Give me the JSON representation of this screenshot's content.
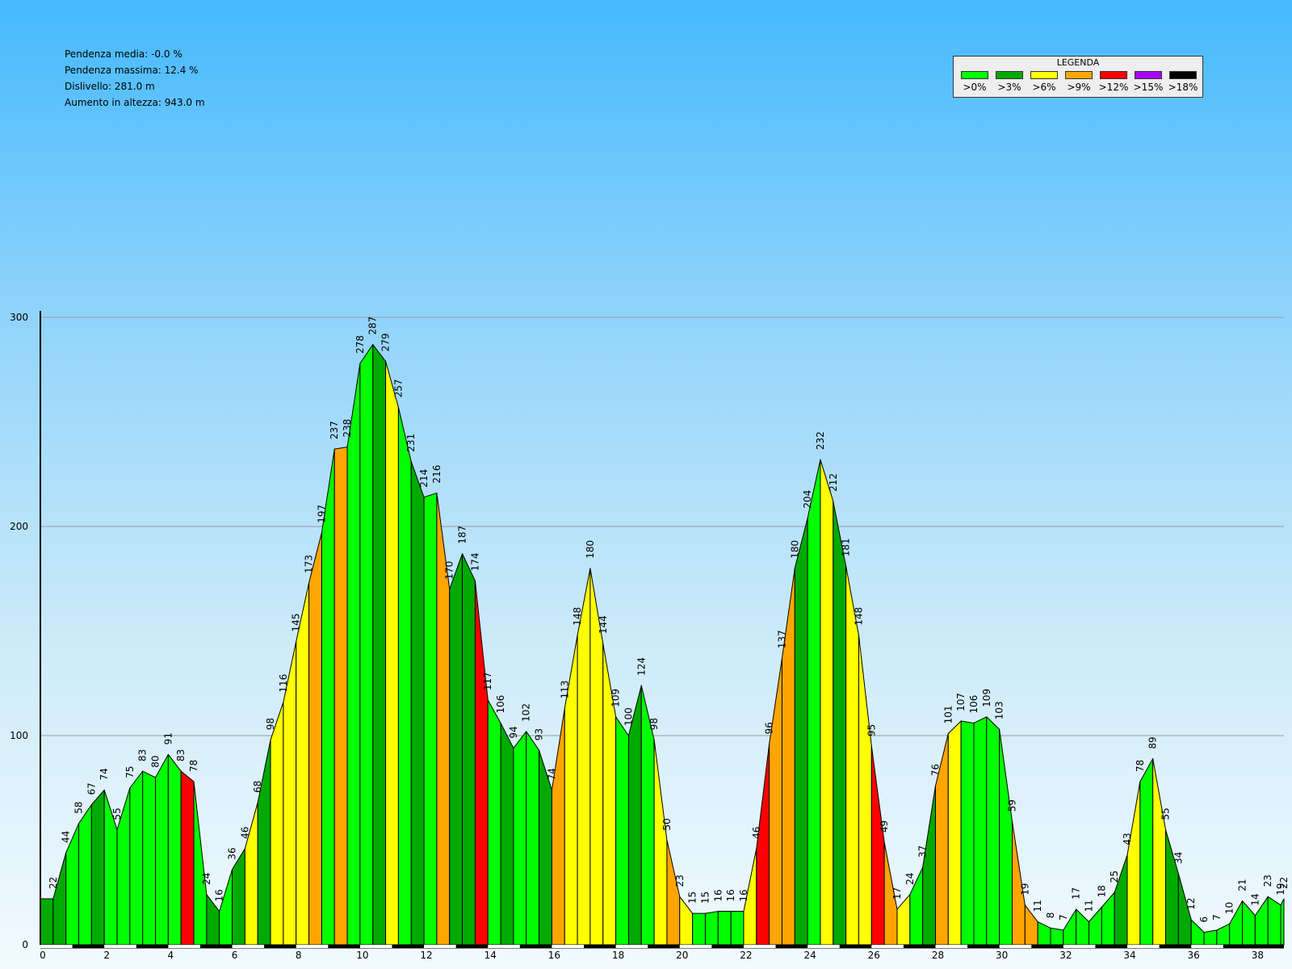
{
  "stats": {
    "avg_slope": "Pendenza media: -0.0 %",
    "max_slope": "Pendenza massima: 12.4 %",
    "elevation_difference": "Dislivello: 281.0 m",
    "elevation_gain": "Aumento in altezza: 943.0 m"
  },
  "legend": {
    "title": "LEGENDA",
    "entries": [
      {
        "label": ">0%",
        "color": "#00ff00"
      },
      {
        "label": ">3%",
        "color": "#00aa00"
      },
      {
        "label": ">6%",
        "color": "#ffff00"
      },
      {
        "label": ">9%",
        "color": "#ffa500"
      },
      {
        "label": ">12%",
        "color": "#ff0000"
      },
      {
        "label": ">15%",
        "color": "#aa00ff"
      },
      {
        "label": ">18%",
        "color": "#000000"
      }
    ]
  },
  "chart_data": {
    "type": "area",
    "title": "",
    "xlabel": "",
    "ylabel": "",
    "xlim": [
      0,
      38.9
    ],
    "ylim": [
      0,
      300
    ],
    "xticks": [
      0,
      2,
      4,
      6,
      8,
      10,
      12,
      14,
      16,
      18,
      20,
      22,
      24,
      26,
      28,
      30,
      32,
      34,
      36,
      38
    ],
    "yticks": [
      0,
      100,
      200,
      300
    ],
    "grid": true,
    "legend_position": "top-right",
    "point_spacing_km": 0.4,
    "elevations": [
      22,
      44,
      58,
      67,
      74,
      55,
      75,
      83,
      80,
      91,
      83,
      78,
      24,
      16,
      36,
      46,
      68,
      98,
      116,
      145,
      173,
      197,
      237,
      238,
      278,
      287,
      279,
      257,
      231,
      214,
      216,
      170,
      187,
      174,
      117,
      106,
      94,
      102,
      93,
      74,
      113,
      148,
      180,
      144,
      109,
      100,
      124,
      98,
      50,
      23,
      15,
      15,
      16,
      16,
      16,
      46,
      96,
      137,
      180,
      204,
      232,
      212,
      181,
      148,
      95,
      49,
      17,
      24,
      37,
      76,
      101,
      107,
      106,
      109,
      103,
      59,
      19,
      11,
      8,
      7,
      17,
      11,
      18,
      25,
      43,
      78,
      89,
      55,
      34,
      12,
      6,
      7,
      10,
      21,
      14,
      23,
      19,
      22
    ],
    "segment_grades": [
      ">3%",
      ">3%",
      ">0%",
      ">0%",
      ">3%",
      ">0%",
      ">0%",
      ">0%",
      ">0%",
      ">0%",
      ">0%",
      ">12%",
      ">0%",
      ">3%",
      ">0%",
      ">3%",
      ">6%",
      ">3%",
      ">6%",
      ">6%",
      ">6%",
      ">9%",
      ">0%",
      ">9%",
      ">0%",
      ">0%",
      ">3%",
      ">6%",
      ">0%",
      ">3%",
      ">0%",
      ">9%",
      ">3%",
      ">3%",
      ">12%",
      ">0%",
      ">3%",
      ">0%",
      ">0%",
      ">3%",
      ">9%",
      ">6%",
      ">6%",
      ">6%",
      ">6%",
      ">0%",
      ">3%",
      ">0%",
      ">6%",
      ">9%",
      ">6%",
      ">0%",
      ">0%",
      ">0%",
      ">0%",
      ">6%",
      ">12%",
      ">9%",
      ">9%",
      ">3%",
      ">0%",
      ">6%",
      ">3%",
      ">6%",
      ">6%",
      ">12%",
      ">9%",
      ">6%",
      ">0%",
      ">3%",
      ">9%",
      ">6%",
      ">0%",
      ">0%",
      ">0%",
      ">0%",
      ">9%",
      ">9%",
      ">0%",
      ">0%",
      ">0%",
      ">0%",
      ">0%",
      ">0%",
      ">3%",
      ">6%",
      ">0%",
      ">6%",
      ">3%",
      ">3%",
      ">0%",
      ">0%",
      ">0%",
      ">0%",
      ">0%",
      ">0%",
      ">0%",
      ">0%"
    ]
  }
}
